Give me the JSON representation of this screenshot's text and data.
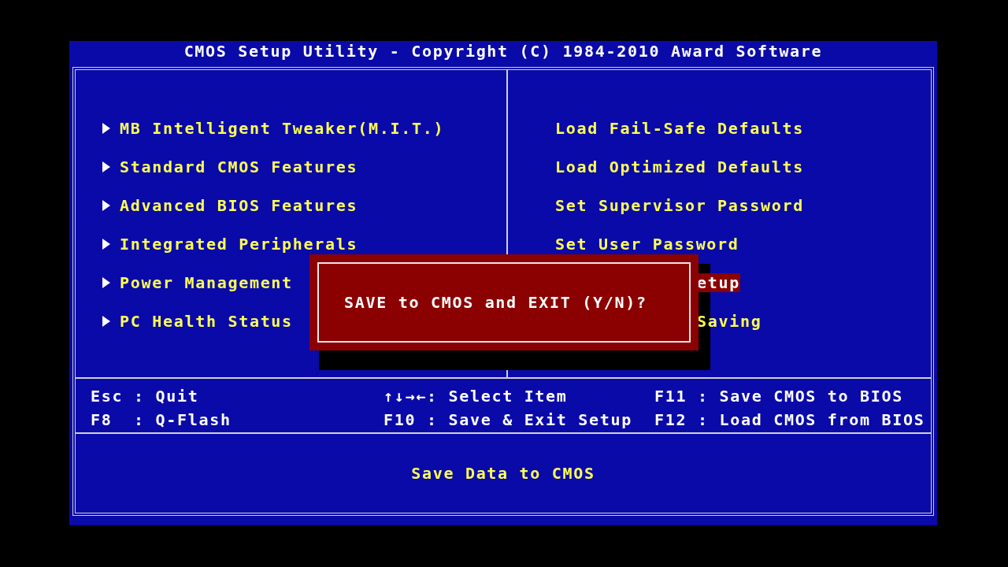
{
  "title": "CMOS Setup Utility - Copyright (C) 1984-2010 Award Software",
  "left_menu": [
    {
      "label": "MB Intelligent Tweaker(M.I.T.)"
    },
    {
      "label": "Standard CMOS Features"
    },
    {
      "label": "Advanced BIOS Features"
    },
    {
      "label": "Integrated Peripherals"
    },
    {
      "label": "Power Management"
    },
    {
      "label": "PC Health Status"
    }
  ],
  "right_menu": [
    {
      "label": "Load Fail-Safe Defaults",
      "kind": "full",
      "selected": false
    },
    {
      "label": "Load Optimized Defaults",
      "kind": "full",
      "selected": false
    },
    {
      "label": "Set Supervisor Password",
      "kind": "full",
      "selected": false
    },
    {
      "label": "Set User Password",
      "kind": "full",
      "selected": false
    },
    {
      "label": "etup",
      "kind": "covered",
      "selected": true
    },
    {
      "label": "Saving",
      "kind": "covered",
      "selected": false
    }
  ],
  "keys": [
    {
      "text": "Esc : Quit"
    },
    {
      "text": "↑↓→←: Select Item"
    },
    {
      "text": "F11 : Save CMOS to BIOS"
    },
    {
      "text": "F8  : Q-Flash"
    },
    {
      "text": "F10 : Save & Exit Setup"
    },
    {
      "text": "F12 : Load CMOS from BIOS"
    }
  ],
  "help": "Save Data to CMOS",
  "dialog": {
    "message": "SAVE to CMOS and EXIT (Y/N)?"
  }
}
